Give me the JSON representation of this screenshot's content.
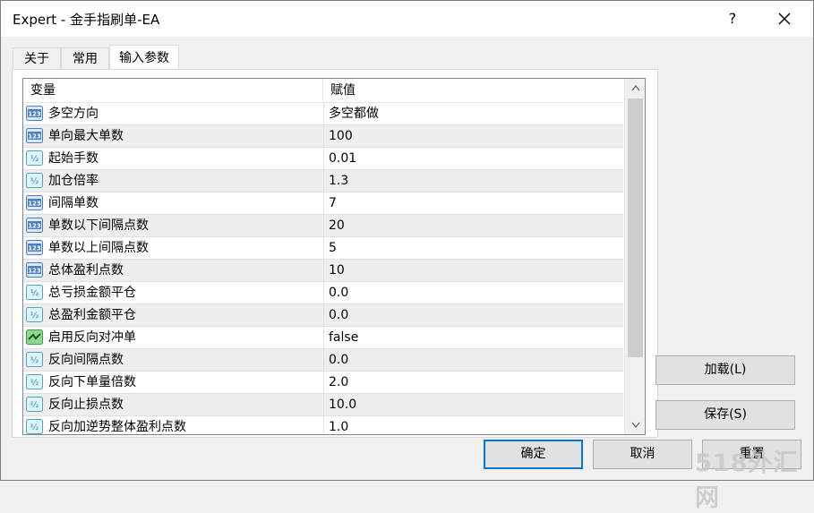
{
  "window": {
    "title": "Expert - 金手指刷单-EA",
    "help_label": "?"
  },
  "tabs": [
    {
      "label": "关于",
      "active": false
    },
    {
      "label": "常用",
      "active": false
    },
    {
      "label": "输入参数",
      "active": true
    }
  ],
  "grid": {
    "columns": {
      "variable": "变量",
      "value": "赋值"
    },
    "rows": [
      {
        "icon": "int-123-icon",
        "name": "多空方向",
        "value": "多空都做"
      },
      {
        "icon": "int-123-icon",
        "name": "单向最大单数",
        "value": "100"
      },
      {
        "icon": "double-half-icon",
        "name": "起始手数",
        "value": "0.01"
      },
      {
        "icon": "double-half-icon",
        "name": "加仓倍率",
        "value": "1.3"
      },
      {
        "icon": "int-123-icon",
        "name": "间隔单数",
        "value": "7"
      },
      {
        "icon": "int-123-icon",
        "name": "单数以下间隔点数",
        "value": "20"
      },
      {
        "icon": "int-123-icon",
        "name": "单数以上间隔点数",
        "value": "5"
      },
      {
        "icon": "int-123-icon",
        "name": "总体盈利点数",
        "value": "10"
      },
      {
        "icon": "double-half-icon",
        "name": "总亏损金额平仓",
        "value": "0.0"
      },
      {
        "icon": "double-half-icon",
        "name": "总盈利金额平仓",
        "value": "0.0"
      },
      {
        "icon": "bool-icon",
        "name": "启用反向对冲单",
        "value": "false"
      },
      {
        "icon": "double-half-icon",
        "name": "反向间隔点数",
        "value": "0.0"
      },
      {
        "icon": "double-half-icon",
        "name": "反向下单量倍数",
        "value": "2.0"
      },
      {
        "icon": "double-half-icon",
        "name": "反向止损点数",
        "value": "10.0"
      },
      {
        "icon": "double-half-icon",
        "name": "反向加逆势整体盈利点数",
        "value": "1.0"
      }
    ]
  },
  "buttons": {
    "load": "加载(L)",
    "save": "保存(S)",
    "ok": "确定",
    "cancel": "取消",
    "reset": "重置"
  },
  "watermark": "518外汇网",
  "colors": {
    "accent": "#0078d7",
    "int_icon": "#4a7fc1",
    "double_icon": "#4aa6c9",
    "bool_icon": "#3aa03a"
  }
}
